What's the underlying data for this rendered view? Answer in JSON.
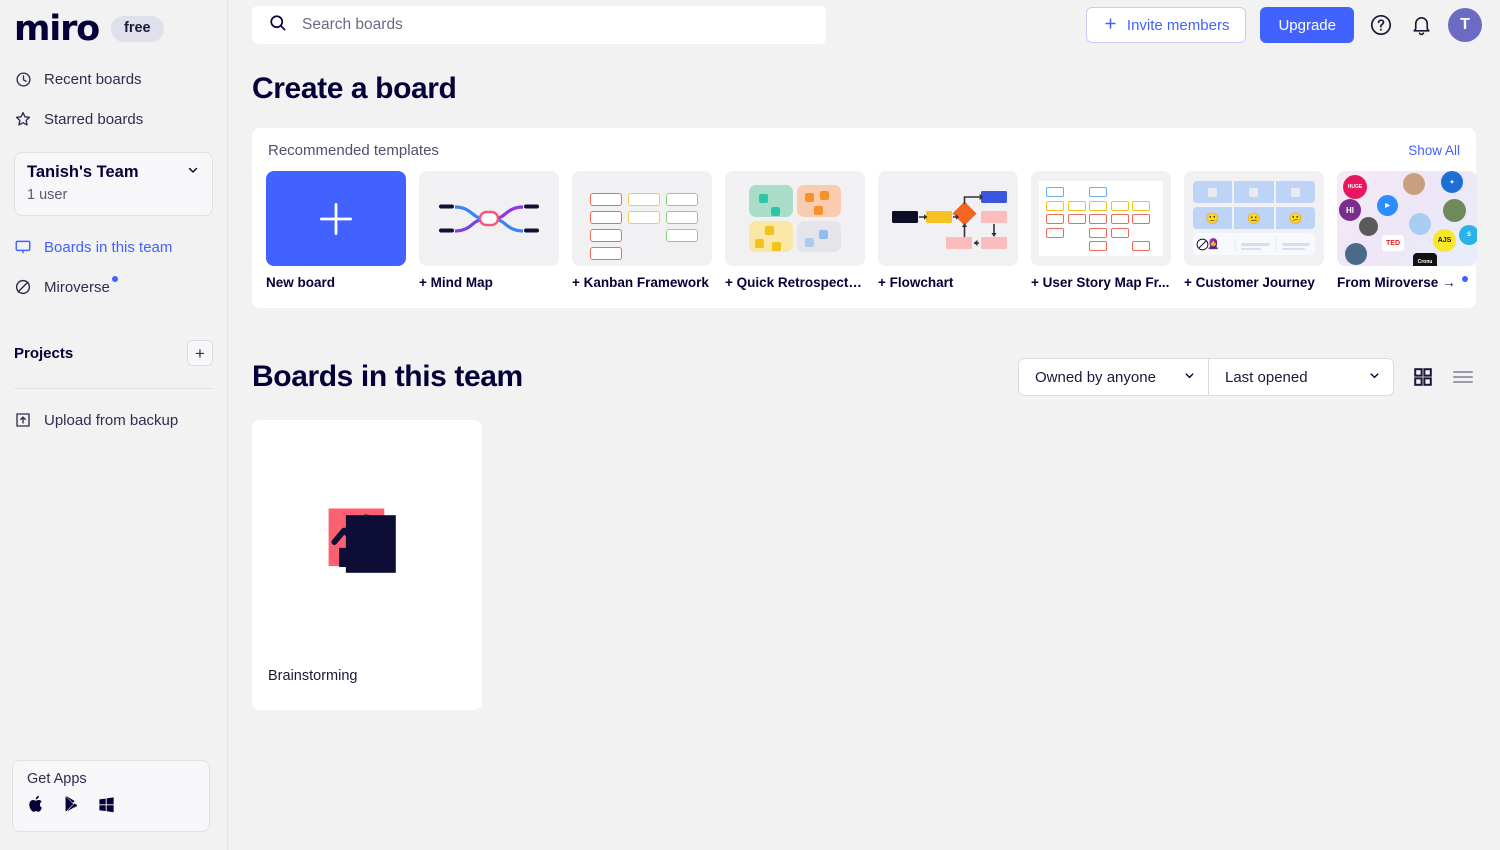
{
  "brand": {
    "logo_text": "miro",
    "plan_badge": "free",
    "accent": "#4262FF",
    "ink": "#050038"
  },
  "sidebar": {
    "nav": [
      {
        "label": "Recent boards",
        "icon": "clock-icon"
      },
      {
        "label": "Starred boards",
        "icon": "star-icon"
      }
    ],
    "team": {
      "name": "Tanish's Team",
      "members": "1 user",
      "caret": "chevron-down-icon"
    },
    "team_nav": [
      {
        "label": "Boards in this team",
        "icon": "board-icon",
        "active": true
      },
      {
        "label": "Miroverse",
        "icon": "planet-icon",
        "badge": true
      }
    ],
    "projects": {
      "title": "Projects",
      "add_label": "+"
    },
    "upload": {
      "label": "Upload from backup",
      "icon": "upload-icon"
    },
    "get_apps": {
      "title": "Get Apps",
      "icons": [
        "apple-icon",
        "google-play-icon",
        "windows-icon"
      ]
    }
  },
  "topbar": {
    "search_placeholder": "Search boards",
    "search_value": "",
    "invite_label": "Invite members",
    "upgrade_label": "Upgrade",
    "help_icon": "help-circle-icon",
    "notifications_icon": "bell-icon",
    "avatar_initial": "T"
  },
  "create": {
    "title": "Create a board",
    "panel_title": "Recommended templates",
    "show_all": "Show All",
    "templates": [
      {
        "label": "New board",
        "thumb": "new-board"
      },
      {
        "label": "+ Mind Map",
        "thumb": "mind-map"
      },
      {
        "label": "+ Kanban Framework",
        "thumb": "kanban"
      },
      {
        "label": "+ Quick Retrospective",
        "thumb": "retrospective"
      },
      {
        "label": "+ Flowchart",
        "thumb": "flowchart"
      },
      {
        "label": "+ User Story Map Fr...",
        "thumb": "user-story-map"
      },
      {
        "label": "+ Customer Journey",
        "thumb": "customer-journey"
      },
      {
        "label": "From Miroverse →",
        "thumb": "miroverse",
        "badge": true
      }
    ]
  },
  "boards": {
    "title": "Boards in this team",
    "filters": [
      {
        "name": "owner-filter",
        "value": "Owned by anyone"
      },
      {
        "name": "sort-filter",
        "value": "Last opened"
      }
    ],
    "views": [
      {
        "name": "grid-view",
        "icon": "grid-icon",
        "active": true
      },
      {
        "name": "list-view",
        "icon": "list-icon",
        "active": false
      }
    ],
    "items": [
      {
        "name": "Brainstorming",
        "thumb": "chart-art"
      }
    ]
  }
}
